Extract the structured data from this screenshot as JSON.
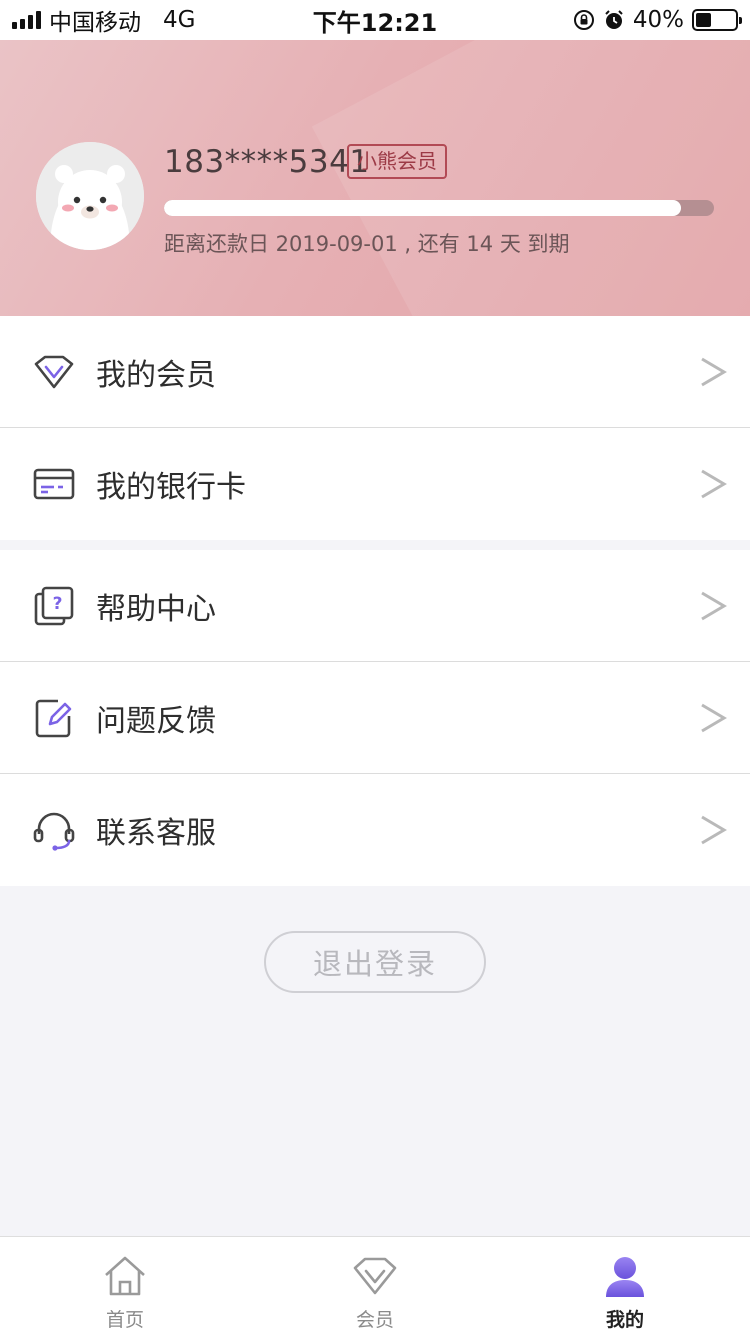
{
  "status_bar": {
    "carrier": "中国移动",
    "network": "4G",
    "time": "下午12:21",
    "battery": "40%",
    "battery_level": 0.4
  },
  "profile": {
    "phone": "183****5341",
    "badge": "小熊会员",
    "progress": 0.94,
    "due_text": "距离还款日 2019-09-01 , 还有 14 天 到期"
  },
  "menu": {
    "group1": [
      {
        "label": "我的会员",
        "icon": "diamond-icon"
      },
      {
        "label": "我的银行卡",
        "icon": "bank-card-icon"
      }
    ],
    "group2": [
      {
        "label": "帮助中心",
        "icon": "help-center-icon"
      },
      {
        "label": "问题反馈",
        "icon": "feedback-icon"
      },
      {
        "label": "联系客服",
        "icon": "headset-icon"
      }
    ]
  },
  "logout_label": "退出登录",
  "tabs": [
    {
      "label": "首页",
      "icon": "home-icon",
      "active": false
    },
    {
      "label": "会员",
      "icon": "diamond-icon",
      "active": false
    },
    {
      "label": "我的",
      "icon": "user-icon",
      "active": true
    }
  ],
  "colors": {
    "accent": "#7b63e6",
    "header": "#e6b0b4",
    "badge": "#b24a55"
  }
}
